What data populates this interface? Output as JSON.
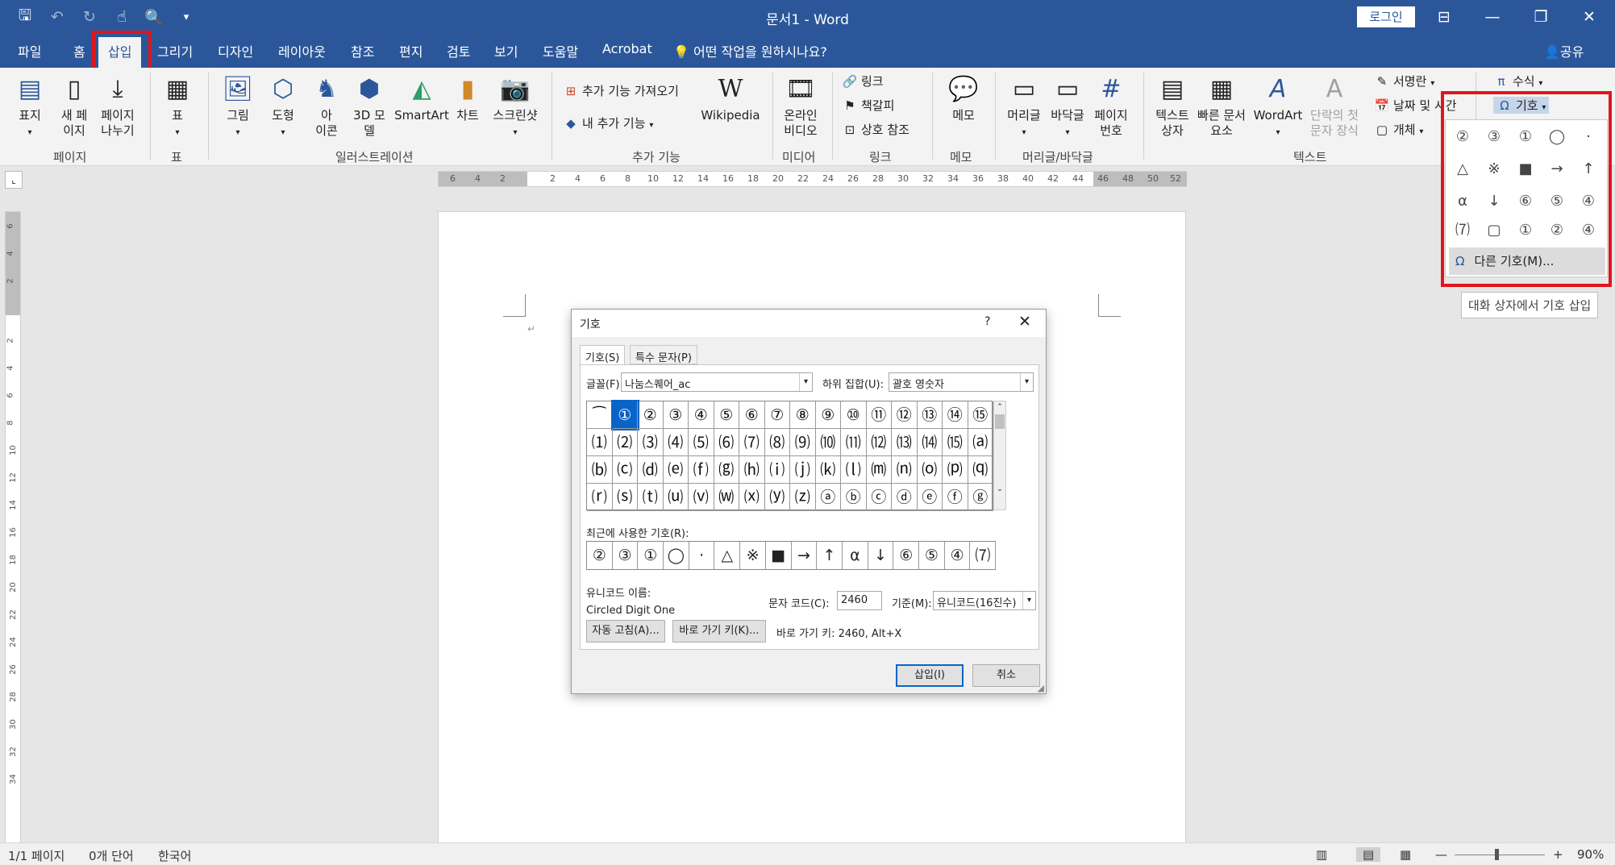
{
  "window": {
    "title": "문서1  -  Word",
    "login": "로그인"
  },
  "tabs": [
    "파일",
    "홈",
    "삽입",
    "그리기",
    "디자인",
    "레이아웃",
    "참조",
    "편지",
    "검토",
    "보기",
    "도움말",
    "Acrobat"
  ],
  "active_tab": "삽입",
  "tell_me": "어떤 작업을 원하시나요?",
  "share": "공유",
  "ribbon": {
    "pages": {
      "cover": "표지",
      "blank": "새 페\n이지",
      "break": "페이지\n나누기",
      "label": "페이지"
    },
    "table": {
      "table": "표",
      "label": "표"
    },
    "illust": {
      "picture": "그림",
      "shapes": "도형",
      "icons": "아\n이콘",
      "model3d": "3D 모\n델",
      "smartart": "SmartArt",
      "chart": "차트",
      "screenshot": "스크린샷",
      "label": "일러스트레이션"
    },
    "addins": {
      "get": "추가 기능 가져오기",
      "my": "내 추가 기능",
      "wikipedia": "Wikipedia",
      "label": "추가 기능"
    },
    "media": {
      "video": "온라인\n비디오",
      "label": "미디어"
    },
    "links": {
      "link": "링크",
      "bookmark": "책갈피",
      "crossref": "상호 참조",
      "label": "링크"
    },
    "comments": {
      "comment": "메모",
      "label": "메모"
    },
    "headerfooter": {
      "header": "머리글",
      "footer": "바닥글",
      "pagenum": "페이지\n번호",
      "label": "머리글/바닥글"
    },
    "text": {
      "textbox": "텍스트\n상자",
      "quickparts": "빠른 문서\n요소",
      "wordart": "WordArt",
      "dropcap": "단락의 첫\n문자 장식",
      "signature": "서명란",
      "datetime": "날짜 및 시간",
      "object": "개체",
      "label": "텍스트"
    },
    "symbols": {
      "equation": "수식",
      "symbol": "기호"
    }
  },
  "symbol_dropdown": {
    "symbols": [
      "②",
      "③",
      "①",
      "◯",
      "·",
      "△",
      "※",
      "■",
      "→",
      "↑",
      "α",
      "↓",
      "⑥",
      "⑤",
      "④",
      "⑺",
      "▢",
      "①",
      "②",
      "④"
    ],
    "more": "다른 기호(M)...",
    "tooltip": "대화 상자에서 기호 삽입"
  },
  "dialog": {
    "title": "기호",
    "help": "?",
    "tab_symbols": "기호(S)",
    "tab_special": "특수 문자(P)",
    "font_label": "글꼴(F):",
    "font_value": "나눔스퀘어_ac",
    "subset_label": "하위 집합(U):",
    "subset_value": "괄호 영숫자",
    "grid": [
      "⁀",
      "①",
      "②",
      "③",
      "④",
      "⑤",
      "⑥",
      "⑦",
      "⑧",
      "⑨",
      "⑩",
      "⑪",
      "⑫",
      "⑬",
      "⑭",
      "⑮",
      "⑴",
      "⑵",
      "⑶",
      "⑷",
      "⑸",
      "⑹",
      "⑺",
      "⑻",
      "⑼",
      "⑽",
      "⑾",
      "⑿",
      "⒀",
      "⒁",
      "⒂",
      "⒜",
      "⒝",
      "⒞",
      "⒟",
      "⒠",
      "⒡",
      "⒢",
      "⒣",
      "⒤",
      "⒥",
      "⒦",
      "⒧",
      "⒨",
      "⒩",
      "⒪",
      "⒫",
      "⒬",
      "⒭",
      "⒮",
      "⒯",
      "⒰",
      "⒱",
      "⒲",
      "⒳",
      "⒴",
      "⒵",
      "ⓐ",
      "ⓑ",
      "ⓒ",
      "ⓓ",
      "ⓔ",
      "ⓕ",
      "ⓖ"
    ],
    "selected_index": 1,
    "recent_label": "최근에 사용한 기호(R):",
    "recent": [
      "②",
      "③",
      "①",
      "◯",
      "·",
      "△",
      "※",
      "■",
      "→",
      "↑",
      "α",
      "↓",
      "⑥",
      "⑤",
      "④",
      "⑺"
    ],
    "unicode_name_label": "유니코드 이름:",
    "unicode_name": "Circled Digit One",
    "charcode_label": "문자 코드(C):",
    "charcode": "2460",
    "base_label": "기준(M):",
    "base_value": "유니코드(16진수)",
    "autocorrect": "자동 고침(A)...",
    "shortcut_btn": "바로 가기 키(K)...",
    "shortcut_text": "바로 가기 키: 2460, Alt+X",
    "insert": "삽입(I)",
    "cancel": "취소"
  },
  "ruler_h": [
    "6",
    "4",
    "2",
    "2",
    "4",
    "6",
    "8",
    "10",
    "12",
    "14",
    "16",
    "18",
    "20",
    "22",
    "24",
    "26",
    "28",
    "30",
    "32",
    "34",
    "36",
    "38",
    "40",
    "42",
    "44",
    "46",
    "48",
    "50",
    "52"
  ],
  "ruler_v": [
    "6",
    "4",
    "2",
    "2",
    "4",
    "6",
    "8",
    "10",
    "12",
    "14",
    "16",
    "18",
    "20",
    "22",
    "24",
    "26",
    "28",
    "30",
    "32",
    "34"
  ],
  "status": {
    "page": "1/1 페이지",
    "words": "0개 단어",
    "lang": "한국어",
    "zoom": "90%"
  },
  "colors": {
    "accent": "#2b579a",
    "highlight": "#e0161c",
    "selection": "#0a64c8"
  }
}
